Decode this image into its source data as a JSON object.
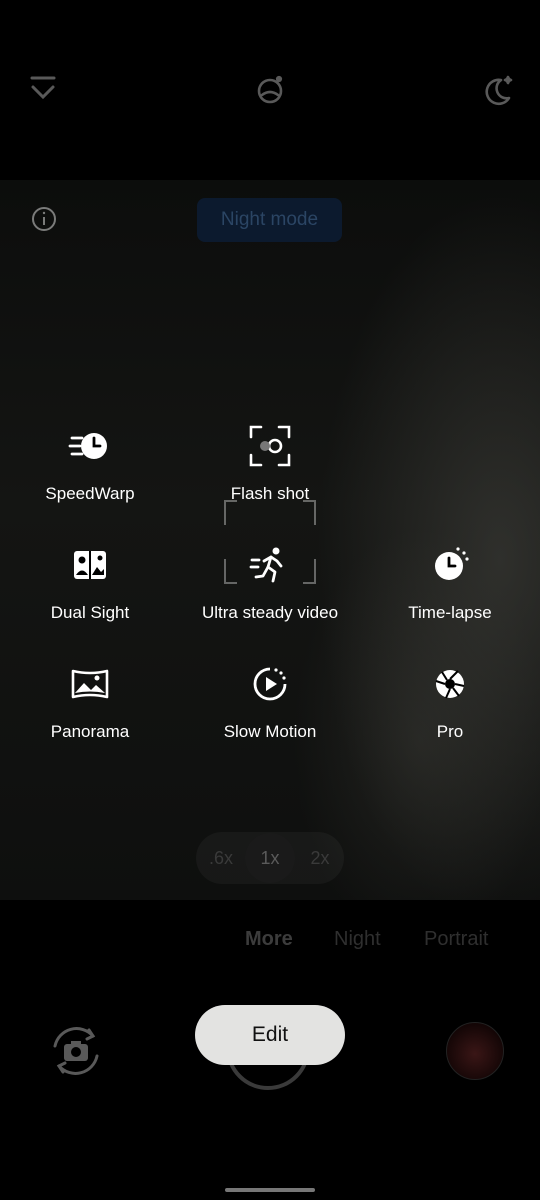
{
  "top_bar": {
    "icons": [
      "chevron-down-line-icon",
      "night-sky-icon",
      "moon-sparkle-icon"
    ]
  },
  "viewfinder": {
    "night_mode_chip": "Night mode",
    "info_icon": "info-icon"
  },
  "more_modes": [
    {
      "label": "SpeedWarp",
      "icon": "speedwarp-icon"
    },
    {
      "label": "Flash shot",
      "icon": "flash-shot-icon"
    },
    {
      "label": "Dual Sight",
      "icon": "dual-sight-icon"
    },
    {
      "label": "Ultra steady video",
      "icon": "running-person-icon"
    },
    {
      "label": "Time-lapse",
      "icon": "timelapse-icon"
    },
    {
      "label": "Panorama",
      "icon": "panorama-icon"
    },
    {
      "label": "Slow Motion",
      "icon": "slow-motion-icon"
    },
    {
      "label": "Pro",
      "icon": "aperture-icon"
    }
  ],
  "zoom": {
    "options": [
      ".6x",
      "1x",
      "2x"
    ],
    "selected": "1x"
  },
  "mode_strip": {
    "tabs": [
      "More",
      "Night",
      "Portrait"
    ],
    "active": "More"
  },
  "controls": {
    "edit_label": "Edit"
  },
  "colors": {
    "edit_button_bg": "#e3e3e1",
    "night_chip_bg": "#0c1a2e"
  }
}
